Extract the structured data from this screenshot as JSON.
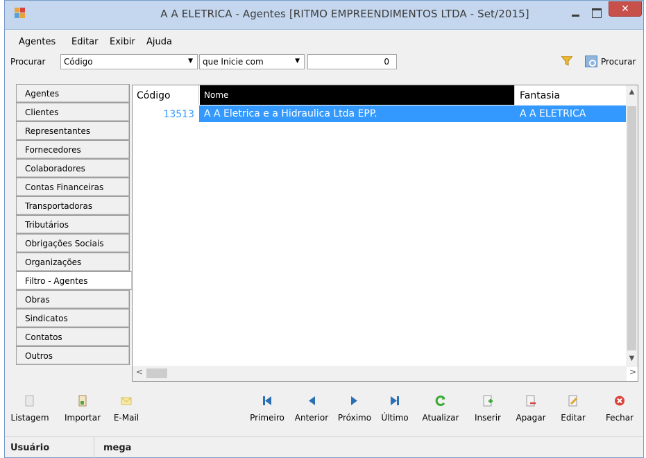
{
  "window": {
    "title": "A A ELETRICA -  Agentes [RITMO EMPREENDIMENTOS LTDA - Set/2015]",
    "close_label": "✕"
  },
  "menu": {
    "items": [
      {
        "label": "Agentes"
      },
      {
        "label": "Editar"
      },
      {
        "label": "Exibir"
      },
      {
        "label": "Ajuda"
      }
    ]
  },
  "search": {
    "label": "Procurar",
    "field": "Código",
    "mode": "que Inicie com",
    "value": "0",
    "button_label": "Procurar"
  },
  "sidebar": {
    "items": [
      {
        "label": "Agentes"
      },
      {
        "label": "Clientes"
      },
      {
        "label": "Representantes"
      },
      {
        "label": "Fornecedores"
      },
      {
        "label": "Colaboradores"
      },
      {
        "label": "Contas Financeiras"
      },
      {
        "label": "Transportadoras"
      },
      {
        "label": "Tributários"
      },
      {
        "label": "Obrigações Sociais"
      },
      {
        "label": "Organizações"
      },
      {
        "label": "Filtro - Agentes"
      },
      {
        "label": "Obras"
      },
      {
        "label": "Sindicatos"
      },
      {
        "label": "Contatos"
      },
      {
        "label": "Outros"
      }
    ],
    "active": "Filtro - Agentes"
  },
  "grid": {
    "columns": [
      "Código",
      "Nome",
      "Fantasia"
    ],
    "rows": [
      {
        "codigo": "13513",
        "nome": "A A Eletrica e a Hidraulica Ltda EPP.",
        "fantasia": "A A ELETRICA"
      }
    ]
  },
  "toolbar": {
    "left": [
      {
        "label": "Listagem"
      },
      {
        "label": "Importar"
      },
      {
        "label": "E-Mail"
      }
    ],
    "nav": [
      {
        "label": "Primeiro"
      },
      {
        "label": "Anterior"
      },
      {
        "label": "Próximo"
      },
      {
        "label": "Último"
      },
      {
        "label": "Atualizar"
      },
      {
        "label": "Inserir"
      },
      {
        "label": "Apagar"
      },
      {
        "label": "Editar"
      },
      {
        "label": "Fechar"
      }
    ]
  },
  "status": {
    "label": "Usuário",
    "value": "mega"
  },
  "colors": {
    "selection": "#3399ff",
    "titlebar": "#c4d7ee",
    "close": "#c7504b"
  }
}
